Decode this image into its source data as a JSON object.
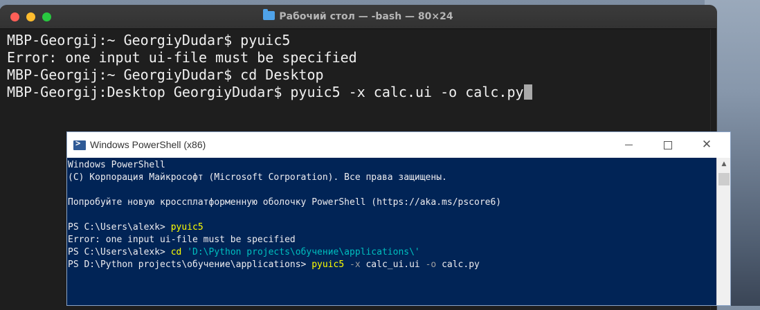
{
  "mac_terminal": {
    "title": "Рабочий стол — -bash — 80×24",
    "lines": [
      "MBP-Georgij:~ GeorgiyDudar$ pyuic5",
      "Error: one input ui-file must be specified",
      "MBP-Georgij:~ GeorgiyDudar$ cd Desktop",
      "MBP-Georgij:Desktop GeorgiyDudar$ pyuic5 -x calc.ui -o calc.py"
    ]
  },
  "powershell": {
    "title": "Windows PowerShell (x86)",
    "header_lines": [
      "Windows PowerShell",
      "(C) Корпорация Майкрософт (Microsoft Corporation). Все права защищены.",
      "",
      "Попробуйте новую кроссплатформенную оболочку PowerShell (https://aka.ms/pscore6)",
      ""
    ],
    "line1_prompt": "PS C:\\Users\\alexk> ",
    "line1_cmd": "pyuic5",
    "line2": "Error: one input ui-file must be specified",
    "line3_prompt": "PS C:\\Users\\alexk> ",
    "line3_cmd": "cd",
    "line3_arg": "'D:\\Python projects\\обучение\\applications\\'",
    "line4_prompt": "PS D:\\Python projects\\обучение\\applications> ",
    "line4_cmd": "pyuic5",
    "line4_p1": "-x",
    "line4_a1": "calc_ui.ui",
    "line4_p2": "-o",
    "line4_a2": "calc.py"
  },
  "colors": {
    "ps_background": "#012456",
    "ps_command": "#ffff00",
    "ps_string": "#00bfbf",
    "terminal_background": "#1e1e1e"
  }
}
